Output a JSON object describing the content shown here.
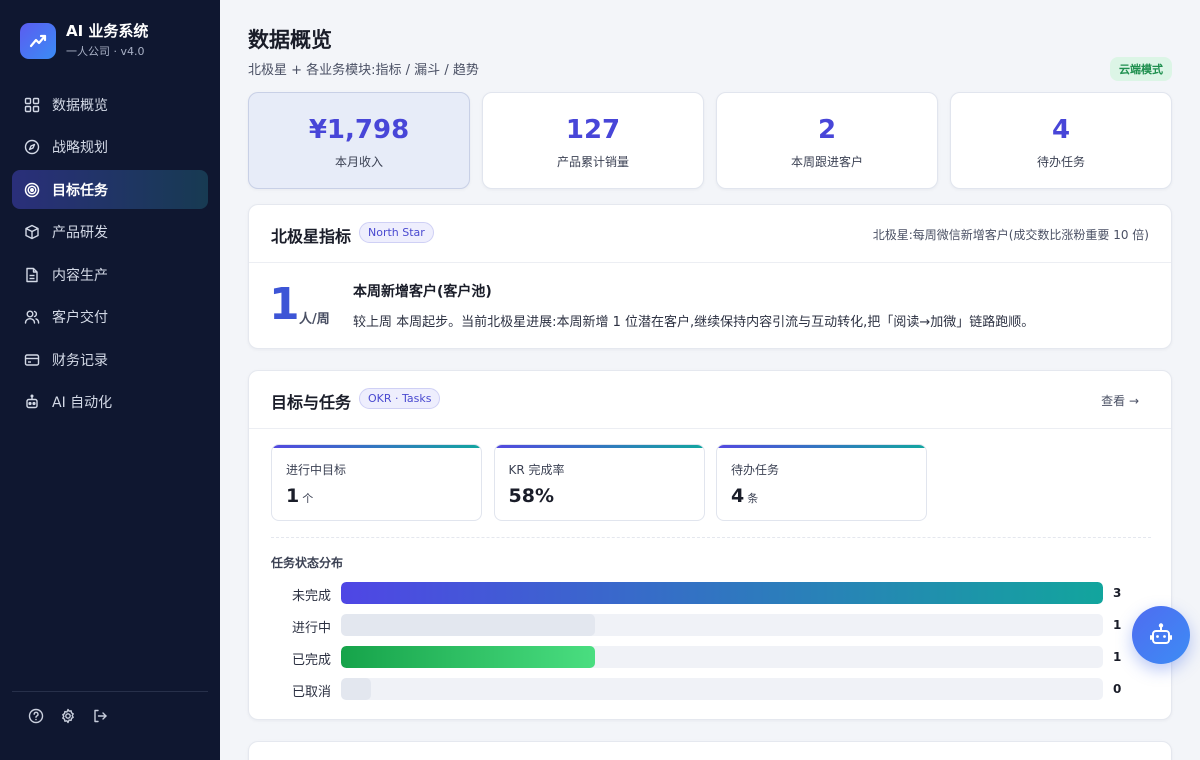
{
  "brand": {
    "title": "AI 业务系统",
    "subtitle": "一人公司 · v4.0",
    "logo_icon": "trend-chart-icon"
  },
  "sidebar": {
    "items": [
      {
        "label": "数据概览",
        "icon": "grid-icon",
        "active": false
      },
      {
        "label": "战略规划",
        "icon": "compass-icon",
        "active": false
      },
      {
        "label": "目标任务",
        "icon": "target-icon",
        "active": true
      },
      {
        "label": "产品研发",
        "icon": "cube-icon",
        "active": false
      },
      {
        "label": "内容生产",
        "icon": "document-icon",
        "active": false
      },
      {
        "label": "客户交付",
        "icon": "users-icon",
        "active": false
      },
      {
        "label": "财务记录",
        "icon": "credit-card-icon",
        "active": false
      },
      {
        "label": "AI 自动化",
        "icon": "robot-icon",
        "active": false
      }
    ],
    "footer_icons": [
      "help-icon",
      "gear-icon",
      "logout-icon"
    ]
  },
  "header": {
    "title": "数据概览",
    "subtitle": "北极星 + 各业务模块:指标 / 漏斗 / 趋势",
    "mode_badge": "云端模式"
  },
  "stats": [
    {
      "value": "¥1,798",
      "label": "本月收入"
    },
    {
      "value": "127",
      "label": "产品累计销量"
    },
    {
      "value": "2",
      "label": "本周跟进客户"
    },
    {
      "value": "4",
      "label": "待办任务"
    }
  ],
  "north_star": {
    "title": "北极星指标",
    "tag": "North Star",
    "note": "北极星:每周微信新增客户(成交数比涨粉重要 10 倍)",
    "value": "1",
    "unit": "人/周",
    "metric_title": "本周新增客户(客户池)",
    "description": "较上周 本周起步。当前北极星进展:本周新增 1 位潜在客户,继续保持内容引流与互动转化,把「阅读→加微」链路跑顺。"
  },
  "okr": {
    "title": "目标与任务",
    "tag": "OKR · Tasks",
    "view_link": "查看 →",
    "cards": [
      {
        "label": "进行中目标",
        "value": "1",
        "unit": "个"
      },
      {
        "label": "KR 完成率",
        "value": "58%",
        "unit": ""
      },
      {
        "label": "待办任务",
        "value": "4",
        "unit": "条"
      }
    ],
    "distribution_title": "任务状态分布",
    "distribution": [
      {
        "label": "未完成",
        "count": "3",
        "fraction": 1.0,
        "style": "gradient"
      },
      {
        "label": "进行中",
        "count": "1",
        "fraction": 0.333,
        "style": "neutral"
      },
      {
        "label": "已完成",
        "count": "1",
        "fraction": 0.333,
        "style": "green"
      },
      {
        "label": "已取消",
        "count": "0",
        "fraction": 0.04,
        "style": "neutral"
      }
    ]
  },
  "assistant": {
    "icon": "robot-icon"
  }
}
